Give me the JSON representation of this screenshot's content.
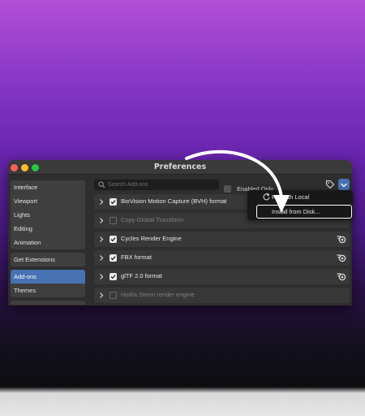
{
  "window": {
    "title": "Preferences"
  },
  "sidebar": {
    "groups": [
      [
        {
          "label": "Interface"
        },
        {
          "label": "Viewport"
        },
        {
          "label": "Lights"
        },
        {
          "label": "Editing"
        },
        {
          "label": "Animation"
        }
      ],
      [
        {
          "label": "Get Extensions"
        }
      ],
      [
        {
          "label": "Add-ons",
          "active": true
        },
        {
          "label": "Themes"
        }
      ]
    ]
  },
  "toolbar": {
    "search_placeholder": "Search Add-ons",
    "search_value": "",
    "enabled_only_label": "Enabled Only",
    "enabled_only_checked": false
  },
  "addons": [
    {
      "name": "BioVision Motion Capture (BVH) format",
      "enabled": true
    },
    {
      "name": "Copy Global Transform",
      "enabled": false
    },
    {
      "name": "Cycles Render Engine",
      "enabled": true
    },
    {
      "name": "FBX format",
      "enabled": true
    },
    {
      "name": "glTF 2.0 format",
      "enabled": true
    },
    {
      "name": "Hydra Storm render engine",
      "enabled": false
    }
  ],
  "dropdown_menu": {
    "items": [
      {
        "label": "Refresh Local",
        "icon": "refresh-icon"
      },
      {
        "label": "Install from Disk...",
        "highlighted": true
      }
    ]
  },
  "colors": {
    "accent": "#4772b3",
    "window_bg": "#2e2e2e",
    "background_top": "#b24fd6",
    "background_bottom": "#0d0d10"
  }
}
